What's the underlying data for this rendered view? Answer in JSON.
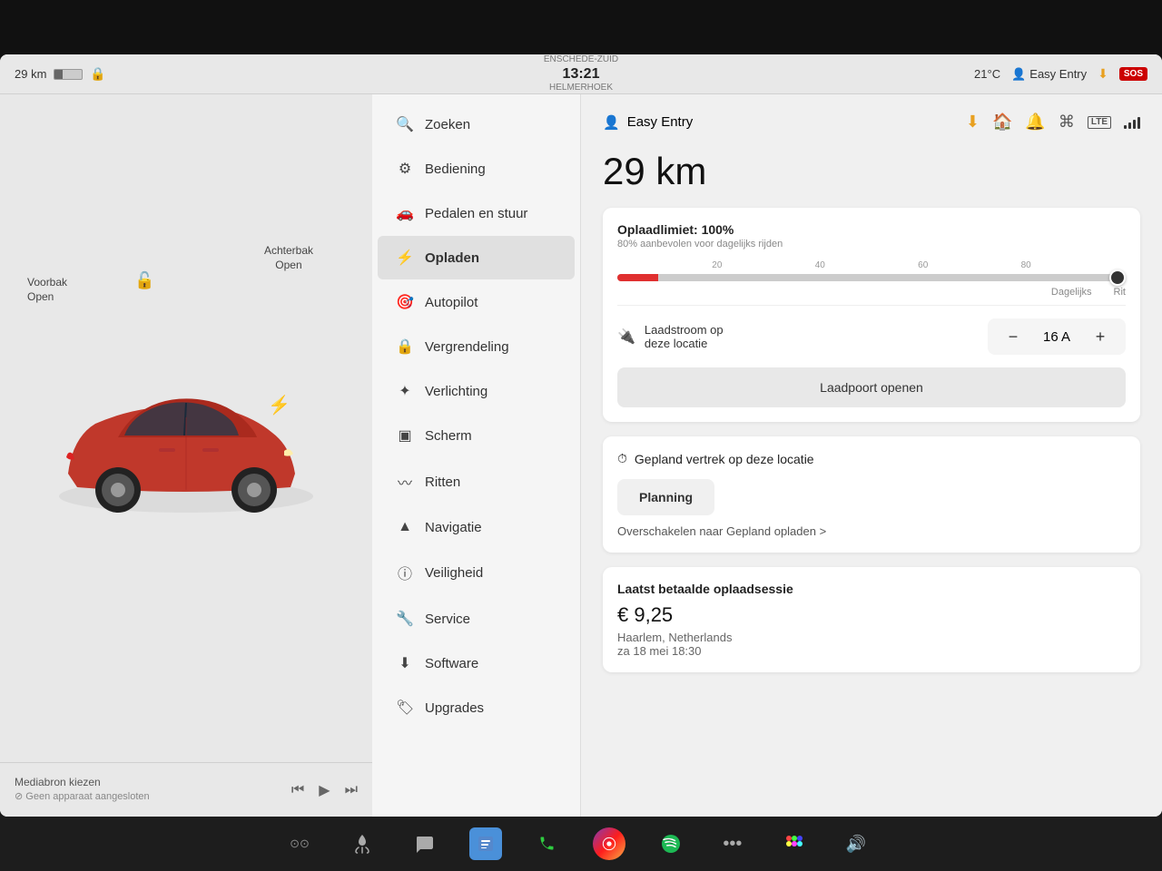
{
  "statusBar": {
    "range": "29 km",
    "location_top": "ENSCHEDE-ZUID",
    "time": "13:21",
    "temperature": "21°C",
    "location_bottom": "HELMERHOEK",
    "profile": "Easy Entry",
    "sos": "SOS"
  },
  "carPanel": {
    "voorbak_label": "Voorbak",
    "voorbak_status": "Open",
    "achterbak_label": "Achterbak",
    "achterbak_status": "Open"
  },
  "mediaBar": {
    "line1": "Mediabron kiezen",
    "line2": "⊘ Geen apparaat aangesloten"
  },
  "sidebar": {
    "items": [
      {
        "id": "zoeken",
        "icon": "🔍",
        "label": "Zoeken"
      },
      {
        "id": "bediening",
        "icon": "⚙",
        "label": "Bediening"
      },
      {
        "id": "pedalen",
        "icon": "🚗",
        "label": "Pedalen en stuur"
      },
      {
        "id": "opladen",
        "icon": "⚡",
        "label": "Opladen",
        "active": true
      },
      {
        "id": "autopilot",
        "icon": "🎯",
        "label": "Autopilot"
      },
      {
        "id": "vergrendeling",
        "icon": "🔒",
        "label": "Vergrendeling"
      },
      {
        "id": "verlichting",
        "icon": "💡",
        "label": "Verlichting"
      },
      {
        "id": "scherm",
        "icon": "🖥",
        "label": "Scherm"
      },
      {
        "id": "ritten",
        "icon": "〰",
        "label": "Ritten"
      },
      {
        "id": "navigatie",
        "icon": "▲",
        "label": "Navigatie"
      },
      {
        "id": "veiligheid",
        "icon": "ℹ",
        "label": "Veiligheid"
      },
      {
        "id": "service",
        "icon": "🔧",
        "label": "Service"
      },
      {
        "id": "software",
        "icon": "⬇",
        "label": "Software"
      },
      {
        "id": "upgrades",
        "icon": "🏷",
        "label": "Upgrades"
      }
    ]
  },
  "content": {
    "profile_name": "Easy Entry",
    "range_km": "29 km",
    "charge_limit_label": "Oplaadlimiet: 100%",
    "charge_limit_sub": "80% aanbevolen voor dagelijks rijden",
    "scale_marks": [
      "20",
      "40",
      "60",
      "80"
    ],
    "charge_label_daily": "Dagelijks",
    "charge_label_trip": "Rit",
    "charge_current_label": "Laadstroom op\ndeze locatie",
    "charge_current_value": "16 A",
    "charge_minus": "−",
    "charge_plus": "+",
    "open_port_btn": "Laadpoort openen",
    "scheduled_header": "Gepland vertrek op deze locatie",
    "planning_btn": "Planning",
    "switch_link": "Overschakelen naar Gepland opladen >",
    "last_session_title": "Laatst betaalde oplaadsessie",
    "last_session_amount": "€ 9,25",
    "last_session_location": "Haarlem, Netherlands",
    "last_session_date": "za 18 mei 18:30"
  },
  "taskbar": {
    "icons": [
      "heat",
      "chat",
      "files",
      "phone",
      "camera",
      "spotify",
      "more",
      "apps",
      "volume"
    ]
  }
}
